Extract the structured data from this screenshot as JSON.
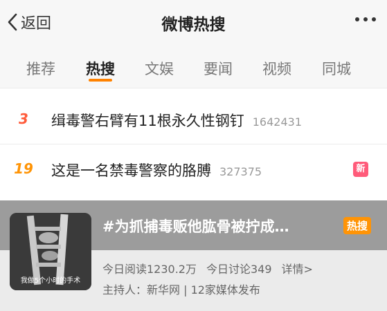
{
  "header": {
    "back_label": "返回",
    "title": "微博热搜"
  },
  "tabs": [
    {
      "label": "推荐",
      "active": false
    },
    {
      "label": "热搜",
      "active": true
    },
    {
      "label": "文娱",
      "active": false
    },
    {
      "label": "要闻",
      "active": false
    },
    {
      "label": "视频",
      "active": false
    },
    {
      "label": "同城",
      "active": false
    }
  ],
  "hot_list": [
    {
      "rank": "3",
      "title": "缉毒警右臂有11根永久性钢钉",
      "count": "1642431",
      "badge": "",
      "rank_color": "#ff5b3a"
    },
    {
      "rank": "19",
      "title": "这是一名禁毒警察的胳膊",
      "count": "327375",
      "badge": "新",
      "rank_color": "#ff9406"
    }
  ],
  "topic_card": {
    "title": "#为抓捕毒贩他肱骨被拧成…",
    "hot_badge": "热搜",
    "thumb_caption": "我做5个小时的手术",
    "reads": "今日阅读1230.2万",
    "discussions": "今日讨论349",
    "details_link": "详情>",
    "host": "主持人：新华网 | 12家媒体发布"
  },
  "colors": {
    "accent": "#ff8200",
    "new_badge": "#ff5b7a",
    "hot_badge": "#ff9406"
  }
}
